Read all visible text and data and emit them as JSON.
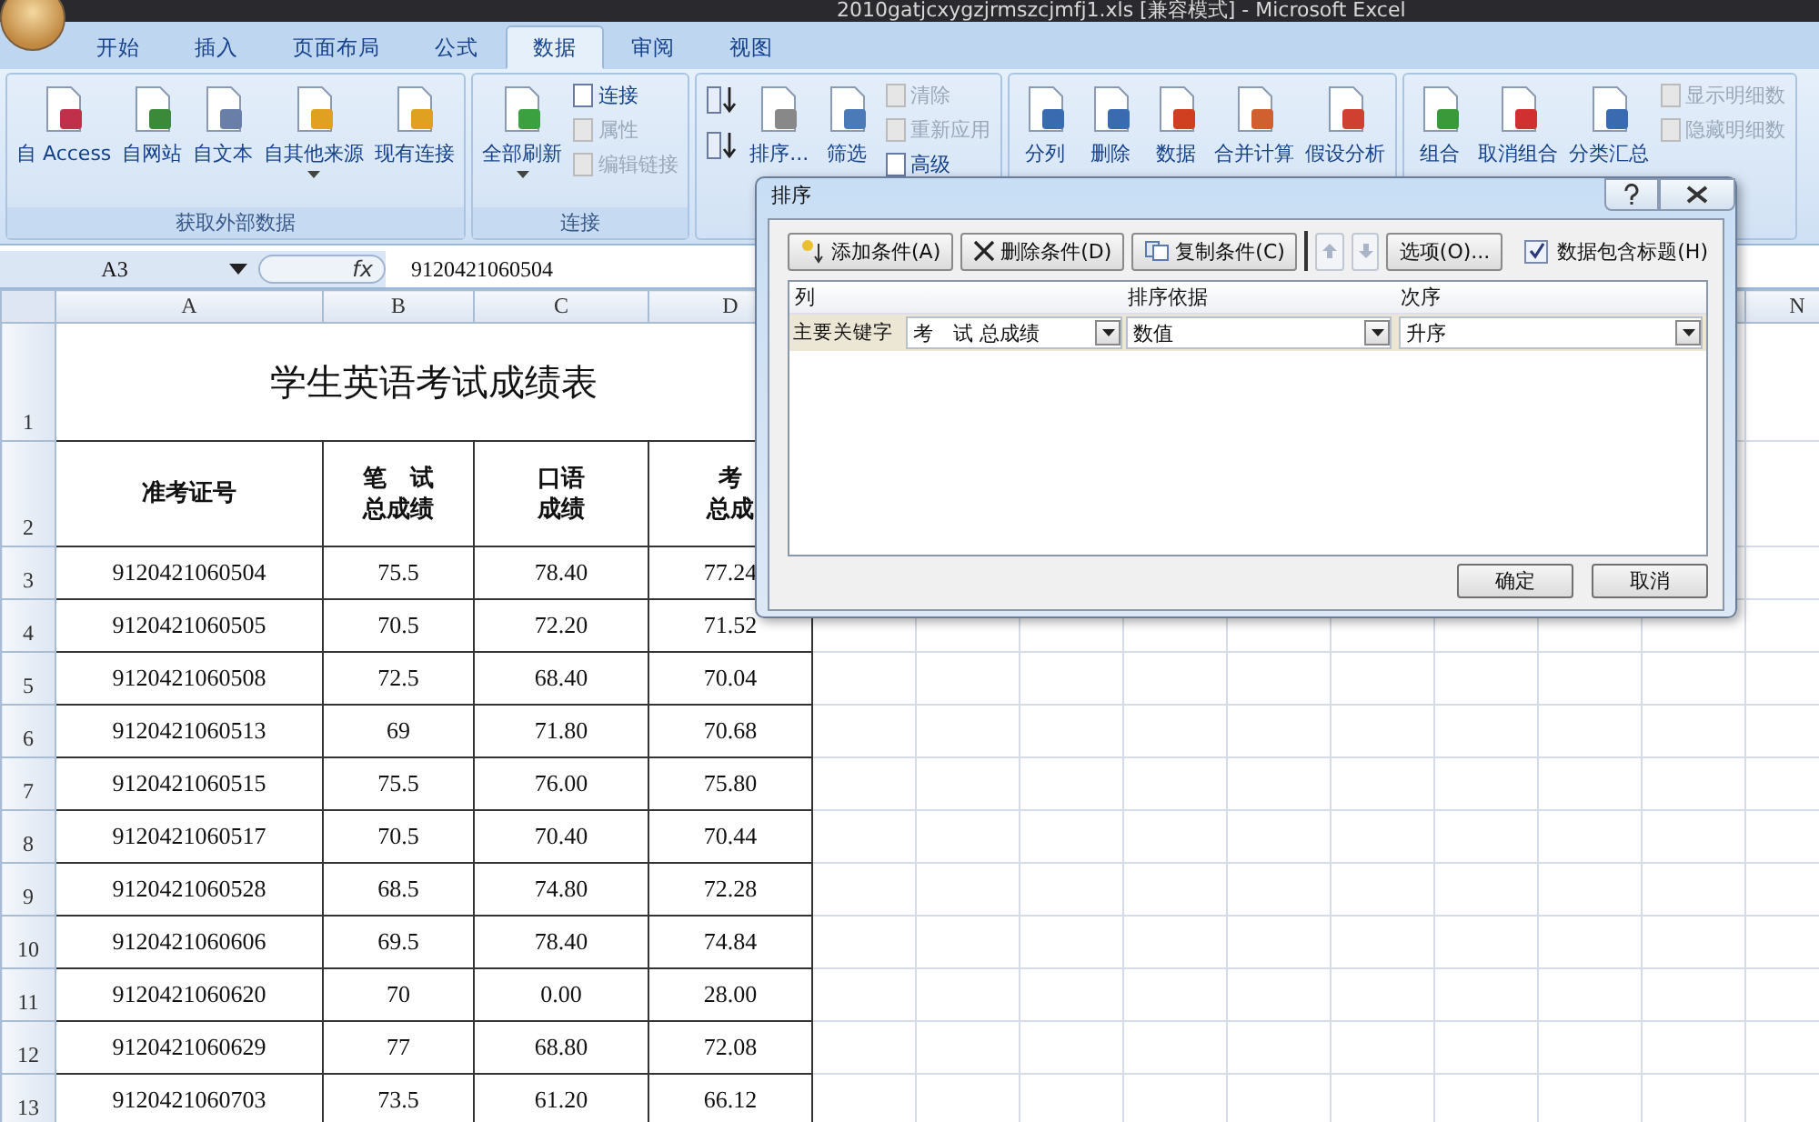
{
  "window": {
    "title": "2010gatjcxygzjrmszcjmfj1.xls  [兼容模式] - Microsoft Excel"
  },
  "ribbon_tabs": [
    {
      "label": "开始",
      "selected": false
    },
    {
      "label": "插入",
      "selected": false
    },
    {
      "label": "页面布局",
      "selected": false
    },
    {
      "label": "公式",
      "selected": false
    },
    {
      "label": "数据",
      "selected": true
    },
    {
      "label": "审阅",
      "selected": false
    },
    {
      "label": "视图",
      "selected": false
    }
  ],
  "ribbon_groups": [
    {
      "label": "获取外部数据",
      "buttons": [
        {
          "kind": "large",
          "label": "自 Access"
        },
        {
          "kind": "large",
          "label": "自网站"
        },
        {
          "kind": "large",
          "label": "自文本"
        },
        {
          "kind": "large",
          "label": "自其他来源",
          "dropdown": true
        },
        {
          "kind": "large",
          "label": "现有连接"
        }
      ]
    },
    {
      "label": "连接",
      "buttons": [
        {
          "kind": "large",
          "label": "全部刷新",
          "dropdown": true
        },
        {
          "kind": "small",
          "label": "连接",
          "disabled": false
        },
        {
          "kind": "small",
          "label": "属性",
          "disabled": true
        },
        {
          "kind": "small",
          "label": "编辑链接",
          "disabled": true
        }
      ]
    },
    {
      "buttons": [
        {
          "kind": "icon"
        },
        {
          "kind": "icon"
        },
        {
          "kind": "large",
          "label": "排序..."
        },
        {
          "kind": "large",
          "label": "筛选"
        },
        {
          "kind": "small",
          "label": "清除",
          "disabled": true
        },
        {
          "kind": "small",
          "label": "重新应用",
          "disabled": true
        },
        {
          "kind": "small",
          "label": "高级",
          "disabled": false
        }
      ]
    },
    {
      "buttons": [
        {
          "kind": "large",
          "label": "分列"
        },
        {
          "kind": "large",
          "label": "删除"
        },
        {
          "kind": "large",
          "label": "数据"
        },
        {
          "kind": "large",
          "label": "合并计算"
        },
        {
          "kind": "large",
          "label": "假设分析"
        }
      ]
    },
    {
      "buttons": [
        {
          "kind": "large",
          "label": "组合"
        },
        {
          "kind": "large",
          "label": "取消组合"
        },
        {
          "kind": "large",
          "label": "分类汇总"
        },
        {
          "kind": "small",
          "label": "显示明细数",
          "disabled": true
        },
        {
          "kind": "small",
          "label": "隐藏明细数",
          "disabled": true
        }
      ]
    }
  ],
  "formula_bar": {
    "name_box": "A3",
    "function_label": "fx",
    "formula": "9120421060504"
  },
  "sheet": {
    "columns": [
      "A",
      "B",
      "C",
      "D"
    ],
    "far_column": "N",
    "title_row": "1",
    "title": "学生英语考试成绩表",
    "header_row": "2",
    "header": [
      [
        "准考证号"
      ],
      [
        "笔　试",
        "总成绩"
      ],
      [
        "口语",
        "成绩"
      ],
      [
        "考",
        "总成"
      ]
    ],
    "rows": [
      {
        "n": "3",
        "cells": [
          "9120421060504",
          "75.5",
          "78.40",
          "77.24"
        ]
      },
      {
        "n": "4",
        "cells": [
          "9120421060505",
          "70.5",
          "72.20",
          "71.52"
        ]
      },
      {
        "n": "5",
        "cells": [
          "9120421060508",
          "72.5",
          "68.40",
          "70.04"
        ]
      },
      {
        "n": "6",
        "cells": [
          "9120421060513",
          "69",
          "71.80",
          "70.68"
        ]
      },
      {
        "n": "7",
        "cells": [
          "9120421060515",
          "75.5",
          "76.00",
          "75.80"
        ]
      },
      {
        "n": "8",
        "cells": [
          "9120421060517",
          "70.5",
          "70.40",
          "70.44"
        ]
      },
      {
        "n": "9",
        "cells": [
          "9120421060528",
          "68.5",
          "74.80",
          "72.28"
        ]
      },
      {
        "n": "10",
        "cells": [
          "9120421060606",
          "69.5",
          "78.40",
          "74.84"
        ]
      },
      {
        "n": "11",
        "cells": [
          "9120421060620",
          "70",
          "0.00",
          "28.00"
        ]
      },
      {
        "n": "12",
        "cells": [
          "9120421060629",
          "77",
          "68.80",
          "72.08"
        ]
      },
      {
        "n": "13",
        "cells": [
          "9120421060703",
          "73.5",
          "61.20",
          "66.12"
        ]
      }
    ]
  },
  "sort_dialog": {
    "title": "排序",
    "toolbar": [
      {
        "kind": "add",
        "label": "添加条件(A)",
        "disabled": false
      },
      {
        "kind": "delete",
        "label": "删除条件(D)",
        "disabled": false
      },
      {
        "kind": "copy",
        "label": "复制条件(C)",
        "disabled": false
      },
      {
        "kind": "up",
        "disabled": true
      },
      {
        "kind": "down",
        "disabled": true
      },
      {
        "kind": "options",
        "label": "选项(O)...",
        "disabled": false
      }
    ],
    "header_checkbox": {
      "label": "数据包含标题(H)",
      "checked": true
    },
    "columns": [
      "列",
      "排序依据",
      "次序"
    ],
    "levels": [
      {
        "label": "主要关键字",
        "column": "考　试 总成绩",
        "sort_on": "数值",
        "order": "升序",
        "selected": true
      }
    ],
    "buttons": [
      "确定",
      "取消"
    ]
  }
}
